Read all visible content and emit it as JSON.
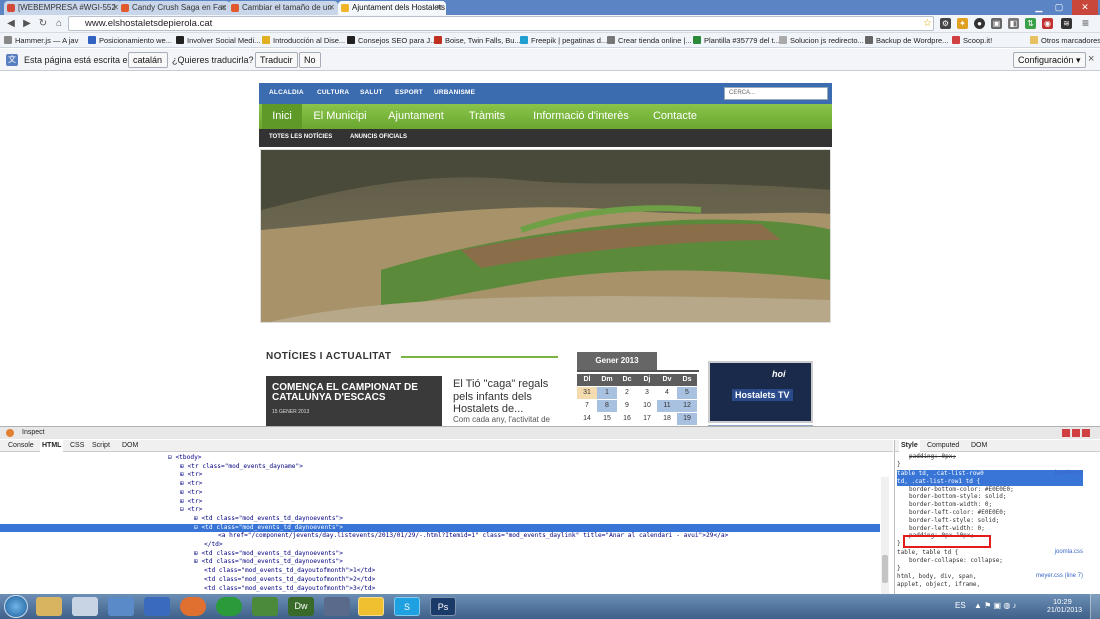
{
  "browser": {
    "tabs": [
      {
        "label": "[WEBEMPRESA #WGI-552",
        "color": "#d44a3a"
      },
      {
        "label": "Candy Crush Saga en Fac",
        "color": "#e05a2c"
      },
      {
        "label": "Cambiar el tamaño de un",
        "color": "#e05a2c"
      },
      {
        "label": "Ajuntament dels Hostalets",
        "color": "#f0b429"
      }
    ],
    "url": "www.elshostaletsdepierola.cat",
    "bookmarks": [
      "Hammer.js — A jav",
      "Posicionamiento we...",
      "Involver Social Medi...",
      "Introducción al Dise...",
      "Consejos SEO para J...",
      "Boise, Twin Falls, Bu...",
      "Freepik | pegatinas d...",
      "Crear tienda online |...",
      "Plantilla #35779 del t...",
      "Solucion js redirecto...",
      "Backup de Wordpre...",
      "Scoop.it!"
    ],
    "other_bookmarks": "Otros marcadores",
    "translate": {
      "prefix": "Esta página está escrita en",
      "language": "catalán",
      "question": "¿Quieres traducirla?",
      "translate_btn": "Traducir",
      "no_btn": "No",
      "config_btn": "Configuración"
    }
  },
  "site": {
    "top_links": [
      "ALCALDIA",
      "CULTURA",
      "SALUT",
      "ESPORT",
      "URBANISME"
    ],
    "search_placeholder": "CERCA...",
    "main_nav": [
      "Inici",
      "El Municipi",
      "Ajuntament",
      "Tràmits",
      "Informació d'interès",
      "Contacte"
    ],
    "sub_nav": [
      "TOTES LES NOTÍCIES",
      "ANUNCIS OFICIALS"
    ],
    "news_heading": "NOTÍCIES I ACTUALITAT",
    "featured": {
      "title": "COMENÇA EL CAMPIONAT DE CATALUNYA D'ESCACS",
      "date": "15 GENER 2013"
    },
    "article": {
      "title": "El Tió \"caga\" regals pels infants dels Hostalets de...",
      "snippet": "Com cada any, l'activitat de"
    },
    "calendar": {
      "month": "Gener 2013",
      "days": [
        "Dl",
        "Dm",
        "Dc",
        "Dj",
        "Dv",
        "Ds"
      ],
      "rows": [
        [
          "31",
          "1",
          "2",
          "3",
          "4",
          "5"
        ],
        [
          "7",
          "8",
          "9",
          "10",
          "11",
          "12"
        ],
        [
          "14",
          "15",
          "16",
          "17",
          "18",
          "19"
        ]
      ]
    },
    "tv_label": "Hostalets TV",
    "tv_logo": "hoi"
  },
  "devtools": {
    "title": "Inspect",
    "tabs": [
      "Console",
      "HTML",
      "CSS",
      "Script",
      "DOM"
    ],
    "side_tabs": [
      "Style",
      "Computed",
      "DOM"
    ],
    "html_lines": [
      "<tbody>",
      "<tr class=\"mod_events_dayname\">",
      "<tr>",
      "<tr>",
      "<tr>",
      "<tr>",
      "<tr>",
      "<td class=\"mod_events_td_daynoevents\">",
      "<td class=\"mod_events_td_daynoevents\">",
      "<a href=\"/component/jevents/day.listevents/2013/01/29/-.html?Itemid=1\" class=\"mod_events_daylink\" title=\"Anar al calendari - avui\">29</a>",
      "</td>",
      "<td class=\"mod_events_td_daynoevents\">",
      "<td class=\"mod_events_td_daynoevents\">",
      "<td class=\"mod_events_td_dayoutofmonth\">1</td>",
      "<td class=\"mod_events_td_dayoutofmonth\">2</td>",
      "<td class=\"mod_events_td_dayoutofmonth\">3</td>"
    ],
    "style_lines": [
      "padding: 0px;",
      "}",
      "table td, .cat-list-row0",
      "td, .cat-list-row1 td {",
      "border-bottom-color: #E0E0E0;",
      "border-bottom-style: solid;",
      "border-bottom-width: 0;",
      "border-left-color: #E0E0E0;",
      "border-left-style: solid;",
      "border-left-width: 0;",
      "padding: 0px 10px;",
      "}",
      "table, table td {",
      "border-collapse: collapse;",
      "}",
      "html, body, div, span,",
      "applet, object, iframe,"
    ],
    "style_sources": [
      "joomla.css",
      "joomla.css",
      "meyer.css (line 7)"
    ]
  },
  "taskbar": {
    "apps": [
      "folder",
      "notepad",
      "pen",
      "firefox",
      "spotify",
      "excel",
      "dreamweaver",
      "app",
      "chrome",
      "skype",
      "photoshop"
    ],
    "app_labels": [
      "",
      "",
      "",
      "",
      "",
      "",
      "Dw",
      "",
      "",
      "S",
      "Ps"
    ],
    "lang": "ES",
    "time": "10:29",
    "date": "21/01/2013"
  }
}
